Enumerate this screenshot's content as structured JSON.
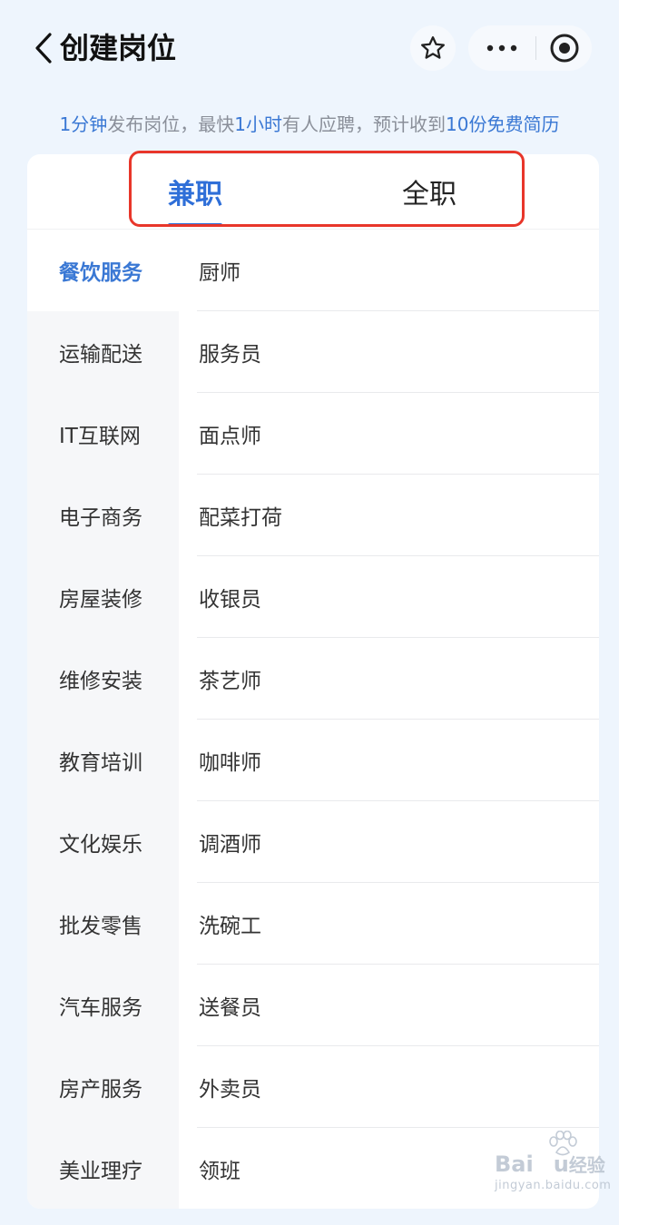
{
  "header": {
    "title": "创建岗位",
    "back_icon": "chevron-left-icon",
    "favorite_icon": "star-outline-icon",
    "more_icon": "more-dots-icon",
    "close_icon": "target-circle-icon"
  },
  "promo": {
    "part1": "1分钟",
    "part2": "发布岗位，最快",
    "part3": "1小时",
    "part4": "有人应聘，预计收到",
    "part5": "10份免费简历"
  },
  "tabs": [
    {
      "label": "兼职",
      "active": true
    },
    {
      "label": "全职",
      "active": false
    }
  ],
  "categories": [
    {
      "label": "餐饮服务",
      "active": true
    },
    {
      "label": "运输配送"
    },
    {
      "label": "IT互联网"
    },
    {
      "label": "电子商务"
    },
    {
      "label": "房屋装修"
    },
    {
      "label": "维修安装"
    },
    {
      "label": "教育培训"
    },
    {
      "label": "文化娱乐"
    },
    {
      "label": "批发零售"
    },
    {
      "label": "汽车服务"
    },
    {
      "label": "房产服务"
    },
    {
      "label": "美业理疗"
    }
  ],
  "jobs": [
    {
      "label": "厨师"
    },
    {
      "label": "服务员"
    },
    {
      "label": "面点师"
    },
    {
      "label": "配菜打荷"
    },
    {
      "label": "收银员"
    },
    {
      "label": "茶艺师"
    },
    {
      "label": "咖啡师"
    },
    {
      "label": "调酒师"
    },
    {
      "label": "洗碗工"
    },
    {
      "label": "送餐员"
    },
    {
      "label": "外卖员"
    },
    {
      "label": "领班"
    }
  ],
  "watermark": {
    "logo_latin": "Bai",
    "logo_latin2": "u",
    "logo_zh": "经验",
    "url": "jingyan.baidu.com"
  },
  "colors": {
    "accent": "#2f6fd8",
    "highlight_box": "#e8362a",
    "background": "#eef5fd"
  }
}
